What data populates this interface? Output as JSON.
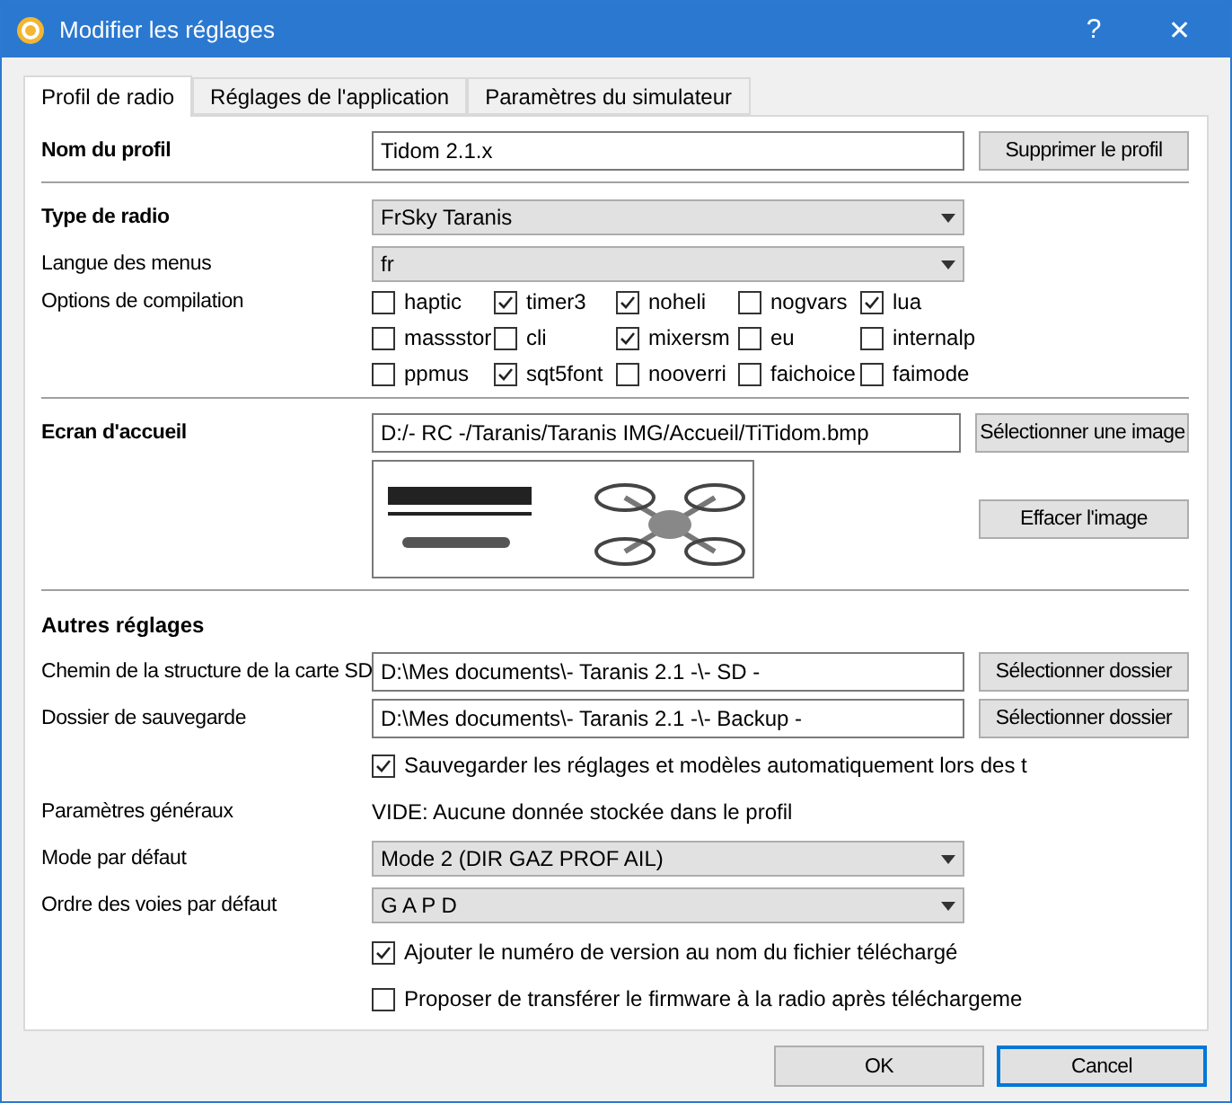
{
  "window": {
    "title": "Modifier les réglages",
    "help": "?",
    "close": "✕"
  },
  "tabs": [
    {
      "label": "Profil de radio",
      "selected": true
    },
    {
      "label": "Réglages de l'application",
      "selected": false
    },
    {
      "label": "Paramètres du simulateur",
      "selected": false
    }
  ],
  "sections": [
    {
      "rows": [
        {
          "kind": "text_field",
          "label": "Nom du profil",
          "bold": true,
          "value": "Tidom 2.1.x",
          "button": "Supprimer le profil"
        }
      ]
    },
    {
      "rows": [
        {
          "kind": "dropdown",
          "label": "Type de radio",
          "bold": true,
          "value": "FrSky Taranis"
        },
        {
          "kind": "dropdown",
          "label": "Langue des menus",
          "bold": false,
          "value": "fr"
        },
        {
          "kind": "checkbox_grid",
          "label": "Options de compilation",
          "bold": false,
          "options": [
            {
              "label": "haptic",
              "checked": false
            },
            {
              "label": "timer3",
              "checked": true
            },
            {
              "label": "noheli",
              "checked": true
            },
            {
              "label": "nogvars",
              "checked": false
            },
            {
              "label": "lua",
              "checked": true
            },
            {
              "label": "massstor",
              "checked": false
            },
            {
              "label": "cli",
              "checked": false
            },
            {
              "label": "mixersm",
              "checked": true
            },
            {
              "label": "eu",
              "checked": false
            },
            {
              "label": "internalp",
              "checked": false
            },
            {
              "label": "ppmus",
              "checked": false
            },
            {
              "label": "sqt5font",
              "checked": true
            },
            {
              "label": "nooverri",
              "checked": false
            },
            {
              "label": "faichoice",
              "checked": false
            },
            {
              "label": "faimode",
              "checked": false
            }
          ]
        }
      ]
    },
    {
      "rows": [
        {
          "kind": "text_field",
          "label": "Ecran d'accueil",
          "bold": true,
          "value": "D:/- RC -/Taranis/Taranis IMG/Accueil/TiTidom.bmp",
          "button": "Sélectionner une image"
        },
        {
          "kind": "image_preview",
          "button": "Effacer l'image"
        }
      ]
    },
    {
      "rows": [
        {
          "kind": "heading",
          "label": "Autres réglages"
        },
        {
          "kind": "text_field",
          "label": "Chemin de la structure de la carte SD",
          "bold": false,
          "value": "D:\\Mes documents\\- Taranis 2.1 -\\- SD -",
          "button": "Sélectionner dossier"
        },
        {
          "kind": "text_field",
          "label": "Dossier de sauvegarde",
          "bold": false,
          "value": "D:\\Mes documents\\- Taranis 2.1 -\\- Backup -",
          "button": "Sélectionner dossier"
        },
        {
          "kind": "checkbox",
          "label": "Sauvegarder les réglages et modèles automatiquement lors des t",
          "checked": true
        },
        {
          "kind": "info",
          "label": "Paramètres généraux",
          "bold": false,
          "value": "VIDE: Aucune donnée stockée dans le profil"
        },
        {
          "kind": "dropdown",
          "label": "Mode par défaut",
          "bold": false,
          "value": "Mode 2 (DIR GAZ PROF AIL)"
        },
        {
          "kind": "dropdown",
          "label": "Ordre des voies par défaut",
          "bold": false,
          "value": "G A P D"
        },
        {
          "kind": "checkbox",
          "label": "Ajouter le numéro de version au nom du fichier téléchargé",
          "checked": true
        },
        {
          "kind": "checkbox",
          "label": "Proposer de transférer le firmware à la radio après téléchargeme",
          "checked": false
        }
      ]
    }
  ],
  "buttons": [
    {
      "label": "OK",
      "default": false
    },
    {
      "label": "Cancel",
      "default": true
    }
  ]
}
